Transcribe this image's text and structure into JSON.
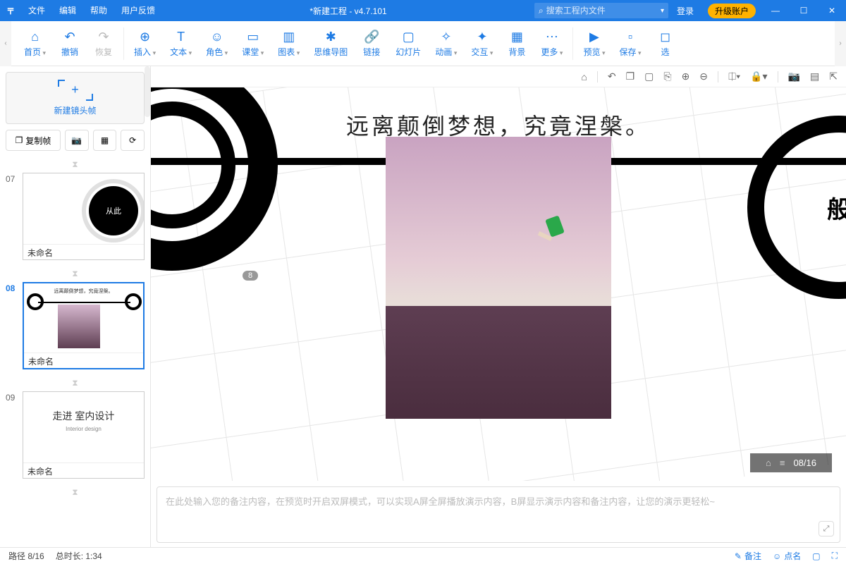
{
  "titlebar": {
    "menus": [
      "文件",
      "编辑",
      "帮助",
      "用户反馈"
    ],
    "title": "*新建工程 - v4.7.101",
    "search_placeholder": "搜索工程内文件",
    "login": "登录",
    "upgrade": "升级账户"
  },
  "ribbon": {
    "items": [
      {
        "label": "首页",
        "icon": "⌂",
        "drop": true
      },
      {
        "label": "撤销",
        "icon": "↶"
      },
      {
        "label": "恢复",
        "icon": "↷",
        "disabled": true
      },
      {
        "div": true
      },
      {
        "label": "插入",
        "icon": "⊕",
        "drop": true
      },
      {
        "label": "文本",
        "icon": "T",
        "drop": true
      },
      {
        "label": "角色",
        "icon": "☺",
        "drop": true
      },
      {
        "label": "课堂",
        "icon": "▭",
        "drop": true
      },
      {
        "label": "图表",
        "icon": "▥",
        "drop": true
      },
      {
        "label": "思维导图",
        "icon": "✱"
      },
      {
        "label": "链接",
        "icon": "🔗"
      },
      {
        "label": "幻灯片",
        "icon": "▢"
      },
      {
        "label": "动画",
        "icon": "✧",
        "drop": true
      },
      {
        "label": "交互",
        "icon": "✦",
        "drop": true
      },
      {
        "label": "背景",
        "icon": "▦"
      },
      {
        "label": "更多",
        "icon": "⋯",
        "drop": true
      },
      {
        "div": true
      },
      {
        "label": "预览",
        "icon": "▶",
        "drop": true
      },
      {
        "label": "保存",
        "icon": "▫",
        "drop": true
      },
      {
        "label": "选",
        "icon": "◻"
      }
    ]
  },
  "side": {
    "new_frame": "新建镜头帧",
    "copy_frame": "复制帧",
    "untitled": "未命名",
    "slides": [
      {
        "num": "07",
        "label": "未命名",
        "inner": "从此"
      },
      {
        "num": "08",
        "label": "未命名",
        "selected": true,
        "inner": "远离颠倒梦想，究竟涅槃。"
      },
      {
        "num": "09",
        "label": "未命名",
        "inner_main": "走进 室内设计",
        "inner_sub": "Interior design"
      }
    ]
  },
  "canvas": {
    "headline": "远离颠倒梦想，究竟涅槃。",
    "badge": "8",
    "ring_right_text": "般",
    "page_indicator": "08/16"
  },
  "notes": {
    "placeholder": "在此处输入您的备注内容，在预览时开启双屏模式，可以实现A屏全屏播放演示内容，B屏显示演示内容和备注内容，让您的演示更轻松~"
  },
  "status": {
    "path": "路径 8/16",
    "duration": "总时长: 1:34",
    "notes_btn": "备注",
    "like_btn": "点名"
  }
}
